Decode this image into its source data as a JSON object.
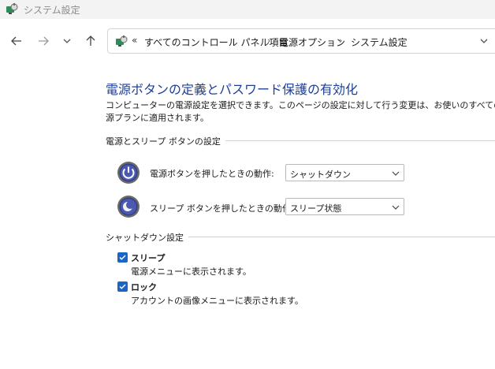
{
  "window": {
    "title": "システム設定"
  },
  "nav": {
    "address_overflow": "«",
    "breadcrumbs": [
      {
        "label": "すべてのコントロール パネル項目"
      },
      {
        "label": "電源オプション"
      },
      {
        "label": "システム設定"
      }
    ],
    "separator": "›"
  },
  "page": {
    "title": "電源ボタンの定義とパスワード保護の有効化",
    "description": "コンピューターの電源設定を選択できます。このページの設定に対して行う変更は、お使いのすべての電源プランに適用されます。"
  },
  "power_buttons": {
    "group_label": "電源とスリープ ボタンの設定",
    "items": [
      {
        "label": "電源ボタンを押したときの動作:",
        "selected": "シャットダウン",
        "icon": "power-icon"
      },
      {
        "label": "スリープ ボタンを押したときの動作:",
        "selected": "スリープ状態",
        "icon": "sleep-moon-icon"
      }
    ]
  },
  "shutdown": {
    "group_label": "シャットダウン設定",
    "items": [
      {
        "title": "スリープ",
        "description": "電源メニューに表示されます。",
        "checked": true
      },
      {
        "title": "ロック",
        "description": "アカウントの画像メニューに表示されます。",
        "checked": true
      }
    ]
  },
  "colors": {
    "accent": "#1a66c7",
    "title": "#1e3f99"
  }
}
